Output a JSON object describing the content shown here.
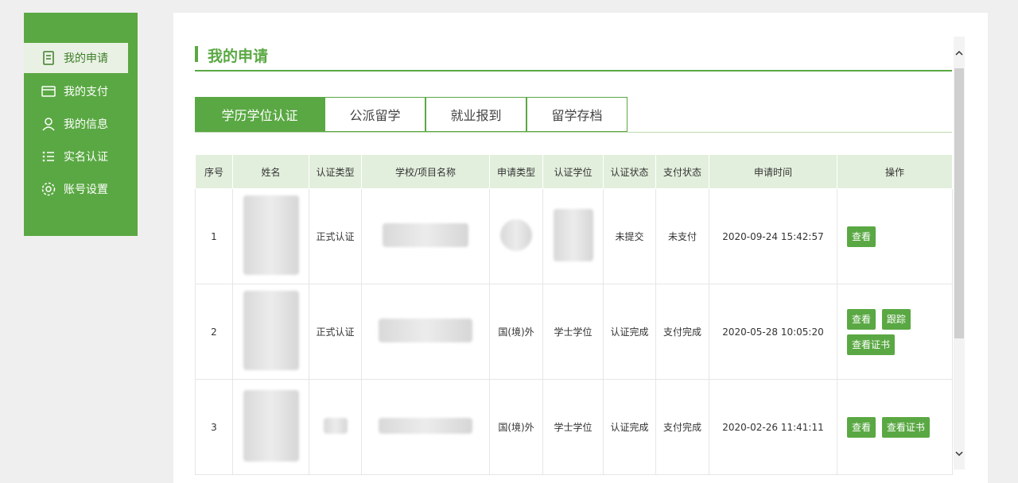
{
  "sidebar": {
    "items": [
      {
        "label": "我的申请",
        "icon": "document-icon",
        "active": true
      },
      {
        "label": "我的支付",
        "icon": "card-icon",
        "active": false
      },
      {
        "label": "我的信息",
        "icon": "user-icon",
        "active": false
      },
      {
        "label": "实名认证",
        "icon": "list-icon",
        "active": false
      },
      {
        "label": "账号设置",
        "icon": "gear-icon",
        "active": false
      }
    ]
  },
  "main": {
    "title": "我的申请",
    "tabs": [
      {
        "label": "学历学位认证",
        "active": true
      },
      {
        "label": "公派留学",
        "active": false
      },
      {
        "label": "就业报到",
        "active": false
      },
      {
        "label": "留学存档",
        "active": false
      }
    ],
    "table": {
      "headers": [
        "序号",
        "姓名",
        "认证类型",
        "学校/项目名称",
        "申请类型",
        "认证学位",
        "认证状态",
        "支付状态",
        "申请时间",
        "操作"
      ],
      "rows": [
        {
          "index": "1",
          "cert_type": "正式认证",
          "apply_type": "",
          "degree": "",
          "status": "未提交",
          "pay_status": "未支付",
          "time": "2020-09-24 15:42:57",
          "actions": [
            "查看"
          ]
        },
        {
          "index": "2",
          "cert_type": "正式认证",
          "apply_type": "国(境)外",
          "degree": "学士学位",
          "status": "认证完成",
          "pay_status": "支付完成",
          "time": "2020-05-28 10:05:20",
          "actions": [
            "查看",
            "跟踪",
            "查看证书"
          ]
        },
        {
          "index": "3",
          "cert_type": "",
          "apply_type": "国(境)外",
          "degree": "学士学位",
          "status": "认证完成",
          "pay_status": "支付完成",
          "time": "2020-02-26 11:41:11",
          "actions": [
            "查看",
            "查看证书"
          ]
        }
      ]
    }
  },
  "colors": {
    "accent": "#5aa843",
    "pending": "#4a90c9",
    "done": "#3dab2e"
  }
}
